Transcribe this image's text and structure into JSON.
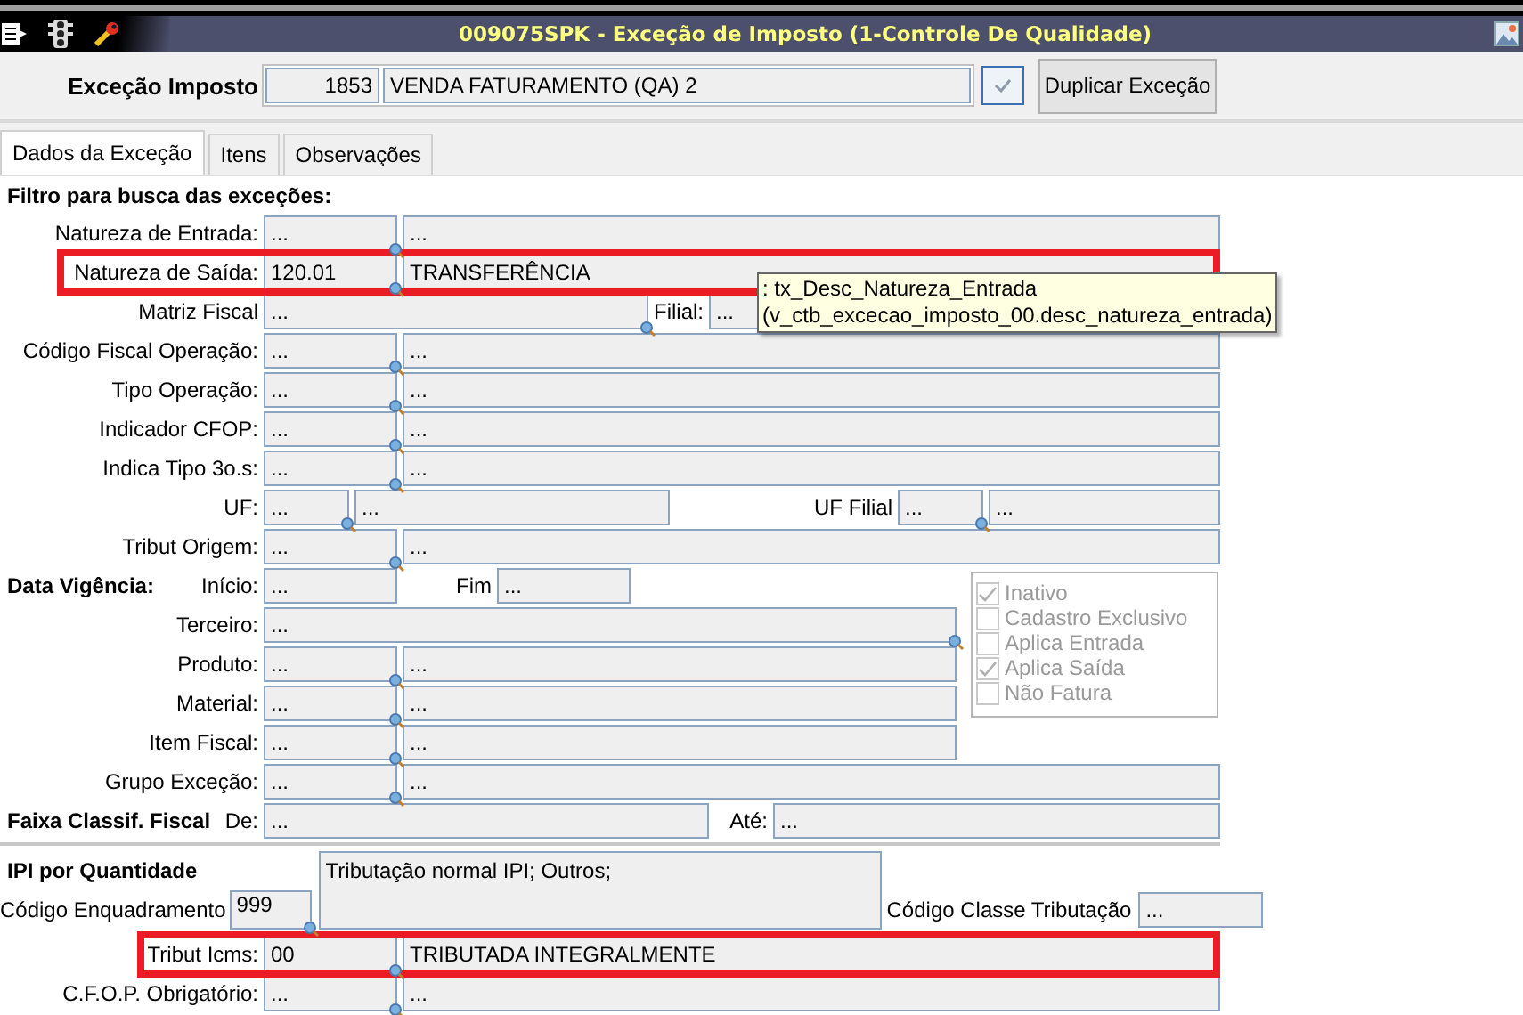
{
  "window": {
    "title": "009075SPK - Exceção de Imposto (1-Controle De Qualidade)"
  },
  "header": {
    "label": "Exceção Imposto",
    "code": "1853",
    "description": "VENDA FATURAMENTO (QA) 2",
    "duplicate_button": "Duplicar Exceção"
  },
  "tabs": [
    {
      "label": "Dados da Exceção",
      "selected": true
    },
    {
      "label": "Itens",
      "selected": false
    },
    {
      "label": "Observações",
      "selected": false
    }
  ],
  "section_title": "Filtro para busca das exceções:",
  "filter_rows": [
    {
      "kind": "lookup",
      "label": "Natureza de Entrada:",
      "code": "...",
      "description": "...",
      "highlighted": false
    },
    {
      "kind": "lookup",
      "label": "Natureza de Saída:",
      "code": "120.01",
      "description": "TRANSFERÊNCIA",
      "highlighted": true
    },
    {
      "kind": "split",
      "label": "Matriz Fiscal",
      "value": "...",
      "sub_label": "Filial:",
      "sub_value": "...",
      "highlighted": false
    },
    {
      "kind": "lookup",
      "label": "Código Fiscal Operação:",
      "code": "...",
      "description": "...",
      "highlighted": false
    },
    {
      "kind": "lookup",
      "label": "Tipo Operação:",
      "code": "...",
      "description": "...",
      "highlighted": false
    },
    {
      "kind": "lookup",
      "label": "Indicador CFOP:",
      "code": "...",
      "description": "...",
      "highlighted": false
    },
    {
      "kind": "lookup",
      "label": "Indica Tipo 3o.s:",
      "code": "...",
      "description": "...",
      "highlighted": false
    },
    {
      "kind": "uf",
      "label": "UF:",
      "code": "...",
      "description": "...",
      "sub_label": "UF Filial",
      "sub_code": "...",
      "sub_description": "...",
      "highlighted": false
    },
    {
      "kind": "lookup",
      "label": "Tribut Origem:",
      "code": "...",
      "description": "...",
      "highlighted": false
    }
  ],
  "tooltip": {
    "lines": [
      ": tx_Desc_Natureza_Entrada",
      "(v_ctb_excecao_imposto_00.desc_natureza_entrada)"
    ]
  },
  "validity_rows": [
    {
      "kind": "dates",
      "group_label": "Data Vigência:",
      "label": "Início:",
      "value": "...",
      "sub_label": "Fim",
      "sub_value": "...",
      "highlighted": false
    },
    {
      "kind": "single",
      "label": "Terceiro:",
      "value": "...",
      "highlighted": false
    },
    {
      "kind": "lookup",
      "label": "Produto:",
      "code": "...",
      "description": "...",
      "highlighted": false
    },
    {
      "kind": "lookup",
      "label": "Material:",
      "code": "...",
      "description": "...",
      "highlighted": false
    },
    {
      "kind": "lookup",
      "label": "Item Fiscal:",
      "code": "...",
      "description": "...",
      "highlighted": false
    }
  ],
  "options": [
    {
      "label": "Inativo",
      "checked": true,
      "disabled": true
    },
    {
      "label": "Cadastro Exclusivo",
      "checked": false,
      "disabled": true
    },
    {
      "label": "Aplica Entrada",
      "checked": false,
      "disabled": true
    },
    {
      "label": "Aplica Saída",
      "checked": true,
      "disabled": true
    },
    {
      "label": "Não Fatura",
      "checked": false,
      "disabled": true
    }
  ],
  "more_rows": [
    {
      "kind": "lookup",
      "label": "Grupo Exceção:",
      "code": "...",
      "description": "...",
      "highlighted": false
    },
    {
      "kind": "range",
      "group_label": "Faixa Classif. Fiscal",
      "label": "De:",
      "value": "...",
      "sub_label": "Até:",
      "sub_value": "...",
      "highlighted": false
    }
  ],
  "ipi": {
    "title": "IPI por Quantidade",
    "code_label": "Código Enquadramento",
    "code": "999",
    "text": "Tributação normal IPI; Outros;",
    "class_label": "Código Classe Tributação",
    "class_value": "..."
  },
  "bottom_rows": [
    {
      "kind": "lookup",
      "label": "Tribut Icms:",
      "code": "00",
      "description": "TRIBUTADA INTEGRALMENTE",
      "highlighted": true
    },
    {
      "kind": "lookup",
      "label": "C.F.O.P. Obrigatório:",
      "code": "...",
      "description": "...",
      "highlighted": false
    }
  ]
}
